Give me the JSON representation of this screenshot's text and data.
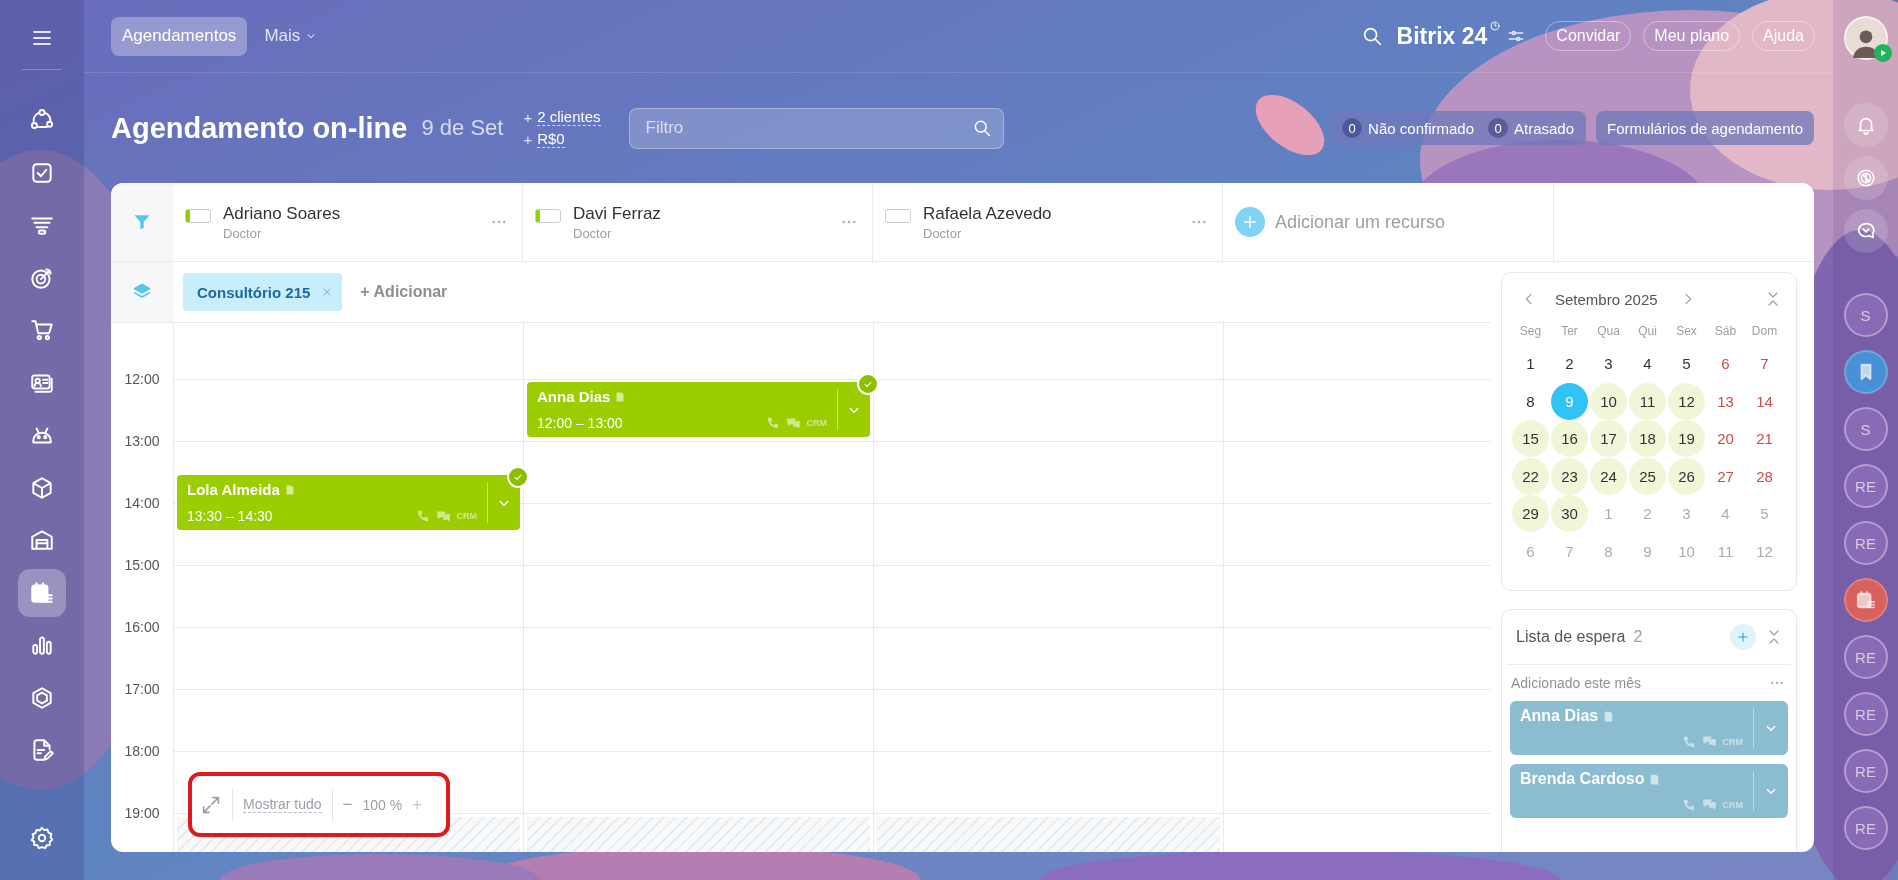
{
  "top_bar": {
    "tabs": [
      {
        "label": "Agendamentos",
        "selected": true,
        "has_menu": false
      },
      {
        "label": "Mais",
        "selected": false,
        "has_menu": true
      }
    ],
    "logo": "Bitrix 24",
    "buttons": [
      "Convidar",
      "Meu plano",
      "Ajuda"
    ]
  },
  "sidebar": {
    "items": [
      {
        "kind": "flow",
        "selected": false
      },
      {
        "kind": "tasks",
        "selected": false
      },
      {
        "kind": "funnel",
        "selected": false
      },
      {
        "kind": "target",
        "selected": false
      },
      {
        "kind": "cart",
        "selected": false
      },
      {
        "kind": "card",
        "selected": false
      },
      {
        "kind": "robot",
        "selected": false
      },
      {
        "kind": "box",
        "selected": false
      },
      {
        "kind": "garage",
        "selected": false
      },
      {
        "kind": "calendar",
        "selected": true
      },
      {
        "kind": "chart",
        "selected": false
      },
      {
        "kind": "hexagon",
        "selected": false
      },
      {
        "kind": "document",
        "selected": false
      }
    ]
  },
  "header": {
    "title": "Agendamento on-line",
    "date": "9 de Set",
    "stats": [
      {
        "prefix": "+",
        "label": "2 clientes"
      },
      {
        "prefix": "+",
        "label": "R$0"
      }
    ],
    "filter": {
      "placeholder": "Filtro"
    },
    "counters": [
      {
        "count": "0",
        "label": "Não confirmado"
      },
      {
        "count": "0",
        "label": "Atrasado"
      }
    ],
    "forms_button": "Formulários de agendamento"
  },
  "board": {
    "resources": [
      {
        "name": "Adriano Soares",
        "role": "Doctor",
        "level": 0.15,
        "appointments": [
          {
            "name": "Lola Almeida",
            "time": "13:30 – 14:30",
            "crm_label": "CRM",
            "confirmed": true
          }
        ]
      },
      {
        "name": "Davi Ferraz",
        "role": "Doctor",
        "level": 0.15,
        "appointments": [
          {
            "name": "Anna Dias",
            "time": "12:00 – 13:00",
            "crm_label": "CRM",
            "confirmed": true
          }
        ]
      },
      {
        "name": "Rafaela Azevedo",
        "role": "Doctor",
        "level": 0
      }
    ],
    "add_resource": "Adicionar um recurso",
    "chips": [
      {
        "label": "Consultório 215"
      }
    ],
    "add_chip": "+ Adicionar",
    "times": [
      "12:00",
      "13:00",
      "14:00",
      "15:00",
      "16:00",
      "17:00",
      "18:00",
      "19:00"
    ],
    "zoom": {
      "show_all": "Mostrar tudo",
      "minus": "−",
      "value": "100 %",
      "plus": "+",
      "highlighted": true
    }
  },
  "calendar": {
    "month": "Setembro 2025",
    "weekdays": [
      "Seg",
      "Ter",
      "Qua",
      "Qui",
      "Sex",
      "Sáb",
      "Dom"
    ],
    "days": [
      {
        "label": "1",
        "kind": "plain",
        "selected": false
      },
      {
        "label": "2",
        "kind": "plain",
        "selected": false
      },
      {
        "label": "3",
        "kind": "plain",
        "selected": false
      },
      {
        "label": "4",
        "kind": "plain",
        "selected": false
      },
      {
        "label": "5",
        "kind": "plain",
        "selected": false
      },
      {
        "label": "6",
        "kind": "weekend",
        "selected": false
      },
      {
        "label": "7",
        "kind": "weekend",
        "selected": false
      },
      {
        "label": "8",
        "kind": "plain",
        "selected": false
      },
      {
        "label": "9",
        "kind": "plain",
        "selected": true
      },
      {
        "label": "10",
        "kind": "free",
        "selected": false
      },
      {
        "label": "11",
        "kind": "free",
        "selected": false
      },
      {
        "label": "12",
        "kind": "free",
        "selected": false
      },
      {
        "label": "13",
        "kind": "weekend",
        "selected": false
      },
      {
        "label": "14",
        "kind": "weekend",
        "selected": false
      },
      {
        "label": "15",
        "kind": "free",
        "selected": false
      },
      {
        "label": "16",
        "kind": "free",
        "selected": false
      },
      {
        "label": "17",
        "kind": "free",
        "selected": false
      },
      {
        "label": "18",
        "kind": "free",
        "selected": false
      },
      {
        "label": "19",
        "kind": "free",
        "selected": false
      },
      {
        "label": "20",
        "kind": "weekend",
        "selected": false
      },
      {
        "label": "21",
        "kind": "weekend",
        "selected": false
      },
      {
        "label": "22",
        "kind": "free",
        "selected": false
      },
      {
        "label": "23",
        "kind": "free",
        "selected": false
      },
      {
        "label": "24",
        "kind": "free",
        "selected": false
      },
      {
        "label": "25",
        "kind": "free",
        "selected": false
      },
      {
        "label": "26",
        "kind": "free",
        "selected": false
      },
      {
        "label": "27",
        "kind": "weekend",
        "selected": false
      },
      {
        "label": "28",
        "kind": "weekend",
        "selected": false
      },
      {
        "label": "29",
        "kind": "free",
        "selected": false
      },
      {
        "label": "30",
        "kind": "free",
        "selected": false
      },
      {
        "label": "1",
        "kind": "other",
        "selected": false
      },
      {
        "label": "2",
        "kind": "other",
        "selected": false
      },
      {
        "label": "3",
        "kind": "other",
        "selected": false
      },
      {
        "label": "4",
        "kind": "other",
        "selected": false
      },
      {
        "label": "5",
        "kind": "other",
        "selected": false
      },
      {
        "label": "6",
        "kind": "other",
        "selected": false
      },
      {
        "label": "7",
        "kind": "other",
        "selected": false
      },
      {
        "label": "8",
        "kind": "other",
        "selected": false
      },
      {
        "label": "9",
        "kind": "other",
        "selected": false
      },
      {
        "label": "10",
        "kind": "other",
        "selected": false
      },
      {
        "label": "11",
        "kind": "other",
        "selected": false
      },
      {
        "label": "12",
        "kind": "other",
        "selected": false
      }
    ]
  },
  "waiting_list": {
    "title": "Lista de espera",
    "count": "2",
    "group": "Adicionado este mês",
    "items": [
      {
        "name": "Anna Dias",
        "crm_label": "CRM"
      },
      {
        "name": "Brenda Cardoso",
        "crm_label": "CRM"
      }
    ]
  },
  "right_bar": {
    "tools": [
      {
        "kind": "bell"
      },
      {
        "kind": "copilot"
      },
      {
        "kind": "chat"
      }
    ],
    "recent": [
      {
        "kind": "avatar",
        "label": "S"
      },
      {
        "kind": "bookmark"
      },
      {
        "kind": "avatar",
        "label": "S"
      },
      {
        "kind": "avatar",
        "label": "RE"
      },
      {
        "kind": "avatar",
        "label": "RE"
      },
      {
        "kind": "calendar"
      },
      {
        "kind": "avatar",
        "label": "RE"
      },
      {
        "kind": "avatar",
        "label": "RE"
      },
      {
        "kind": "avatar",
        "label": "RE"
      },
      {
        "kind": "avatar",
        "label": "RE"
      }
    ]
  }
}
